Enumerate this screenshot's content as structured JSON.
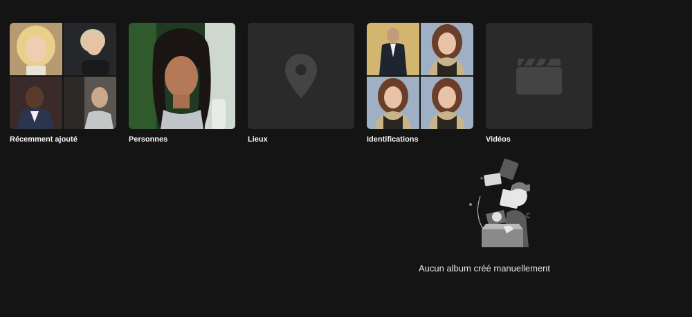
{
  "albums": [
    {
      "label": "Récemment ajouté",
      "kind": "photo-grid"
    },
    {
      "label": "Personnes",
      "kind": "photo"
    },
    {
      "label": "Lieux",
      "kind": "placeholder",
      "icon": "map-pin-icon"
    },
    {
      "label": "Identifications",
      "kind": "photo-grid"
    },
    {
      "label": "Vidéos",
      "kind": "placeholder",
      "icon": "clapperboard-icon"
    }
  ],
  "empty_state": {
    "message": "Aucun album créé manuellement",
    "illustration": "person-opening-box-illustration"
  },
  "colors": {
    "background": "#141414",
    "tile_placeholder": "#2a2a2a",
    "icon_gray": "#444444",
    "text": "#f5f5f5"
  }
}
